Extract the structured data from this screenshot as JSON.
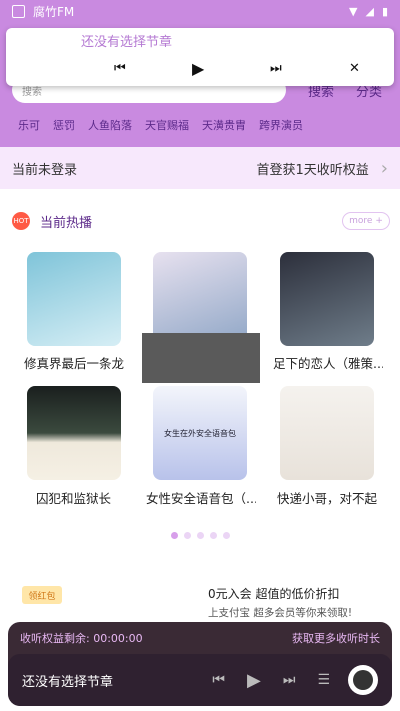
{
  "status_bar": {
    "app_name": "腐竹FM"
  },
  "float_player": {
    "title": "还没有选择节章"
  },
  "search": {
    "placeholder": "搜索",
    "search_label": "搜索",
    "category_label": "分类"
  },
  "tags": [
    "乐可",
    "惩罚",
    "人鱼陷落",
    "天官赐福",
    "天潢贵胄",
    "跨界演员"
  ],
  "login_bar": {
    "status": "当前未登录",
    "promo": "首登获1天收听权益"
  },
  "hot": {
    "title": "当前热播",
    "icon_text": "HOT",
    "more_label": "more +",
    "items": [
      {
        "title": "修真界最后一条龙"
      },
      {
        "title": ""
      },
      {
        "title": "足下的恋人（雅策..."
      },
      {
        "title": "囚犯和监狱长"
      },
      {
        "title": "女性安全语音包（..."
      },
      {
        "title": "快递小哥，对不起"
      }
    ],
    "cover5_text": "女生在外安全语音包"
  },
  "ad": {
    "badge": "领红包",
    "title": "0元入会 超值的低价折扣",
    "subtitle": "上支付宝 超多会员等你来领取!"
  },
  "bottom_player": {
    "remaining": "收听权益剩余: 00:00:00",
    "more_time": "获取更多收听时长",
    "title": "还没有选择节章"
  },
  "colors": {
    "accent": "#c98ae0",
    "tag_text": "#5c2a8a",
    "player_bg": "#3a2a35"
  }
}
